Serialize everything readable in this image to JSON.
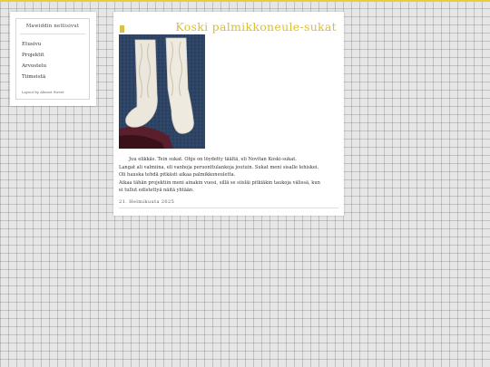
{
  "sidebar": {
    "title": "Mawiddin nettisivut",
    "nav": [
      "Etusivu",
      "Projektit",
      "Arvostelu",
      "Tiimeistä"
    ],
    "credit": "Layout by Almost Sweet"
  },
  "post": {
    "title": "Koski palmikkoneule-sukat",
    "paragraphs": [
      "Juu elikkäs. Tein sukat. Ohje on löydetty täältä, eli Novitan Koski-sukat.",
      "Langat ali valmiina, eli vanhoja peruonttulankoja joutuin. Sukat meni sisalle lehiskei.",
      "Oli hauska tehdä pitkästi aikaa palmikkoneuletta.",
      "Aikaa tähän projektiin meni ainakin vuosi, sillä se siisläi pitkiäkin taukoja välissä, kun",
      "ei tullut edistettyä näitä yhtään."
    ],
    "date": "21. Helmikuuta 2025",
    "image_alt": "valkoiset palmikkoneulesukat"
  },
  "colors": {
    "accent": "#e8cf3a",
    "title": "#d7bf38"
  }
}
